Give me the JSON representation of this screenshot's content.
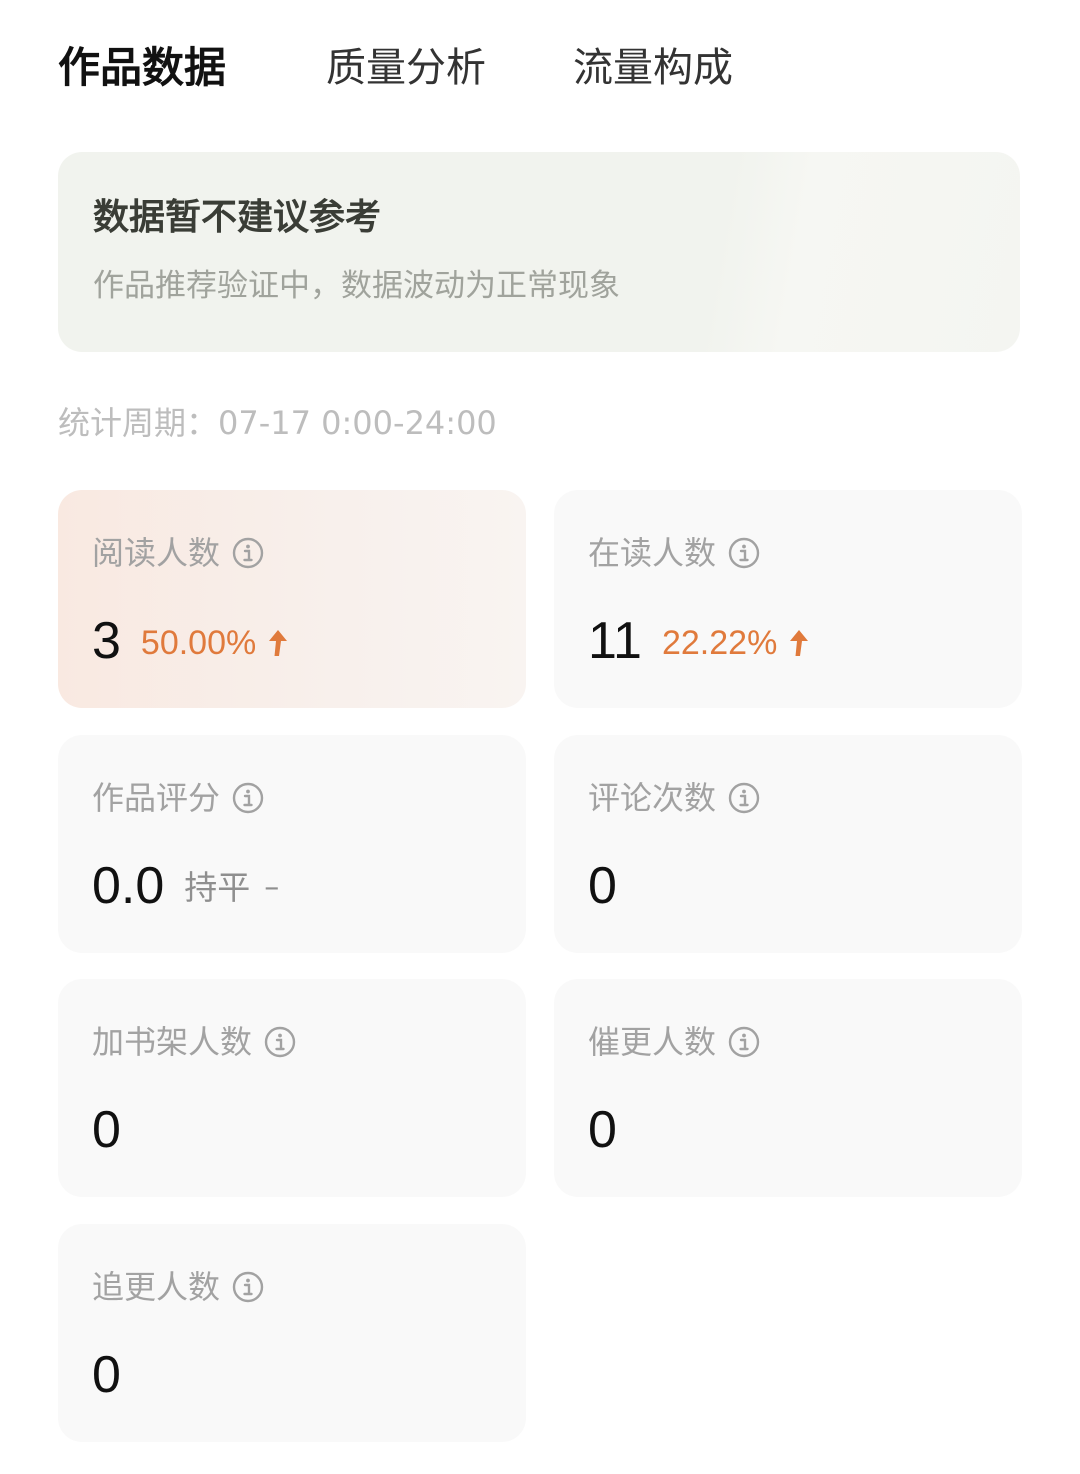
{
  "tabs": [
    {
      "label": "作品数据",
      "active": true
    },
    {
      "label": "质量分析",
      "active": false
    },
    {
      "label": "流量构成",
      "active": false
    }
  ],
  "notice": {
    "title": "数据暂不建议参考",
    "subtitle": "作品推荐验证中，数据波动为正常现象"
  },
  "period": {
    "label": "统计周期：07-17 0:00-24:00"
  },
  "metrics": [
    {
      "label": "阅读人数",
      "value": "3",
      "change": "50.00%",
      "trend": "up",
      "highlight": true
    },
    {
      "label": "在读人数",
      "value": "11",
      "change": "22.22%",
      "trend": "up"
    },
    {
      "label": "作品评分",
      "value": "0.0",
      "change": "持平",
      "trend": "flat",
      "flat_mark": "–"
    },
    {
      "label": "评论次数",
      "value": "0"
    },
    {
      "label": "加书架人数",
      "value": "0"
    },
    {
      "label": "催更人数",
      "value": "0"
    },
    {
      "label": "追更人数",
      "value": "0"
    }
  ],
  "colors": {
    "accent_up": "#e07a3c",
    "highlight_card": "#f9e9e1",
    "card_bg": "#f9f9f9",
    "notice_bg": "#f1f3ee"
  },
  "icons": {
    "info": "info-icon",
    "up_arrow": "up-arrow-icon"
  }
}
